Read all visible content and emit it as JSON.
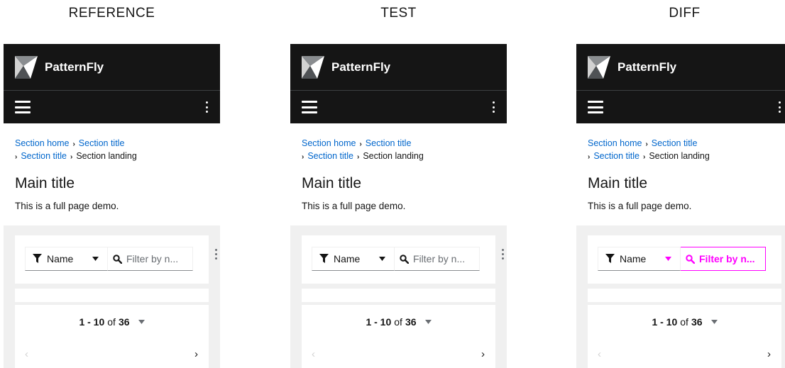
{
  "columns": [
    {
      "label": "REFERENCE"
    },
    {
      "label": "TEST"
    },
    {
      "label": "DIFF"
    }
  ],
  "masthead": {
    "brand": "PatternFly"
  },
  "breadcrumb": {
    "items": [
      "Section home",
      "Section title",
      "Section title"
    ],
    "current": "Section landing"
  },
  "page": {
    "title": "Main title",
    "description": "This is a full page demo."
  },
  "toolbar": {
    "filter_label": "Name",
    "search_placeholder": "Filter by n..."
  },
  "pagination": {
    "range": "1 - 10",
    "of": "of",
    "total": "36",
    "prev_glyph": "‹",
    "next_glyph": "›"
  },
  "colors": {
    "masthead_bg": "#151515",
    "link": "#0066cc",
    "gray_area": "#f0f0f0",
    "diff_highlight": "#ff00ff"
  }
}
